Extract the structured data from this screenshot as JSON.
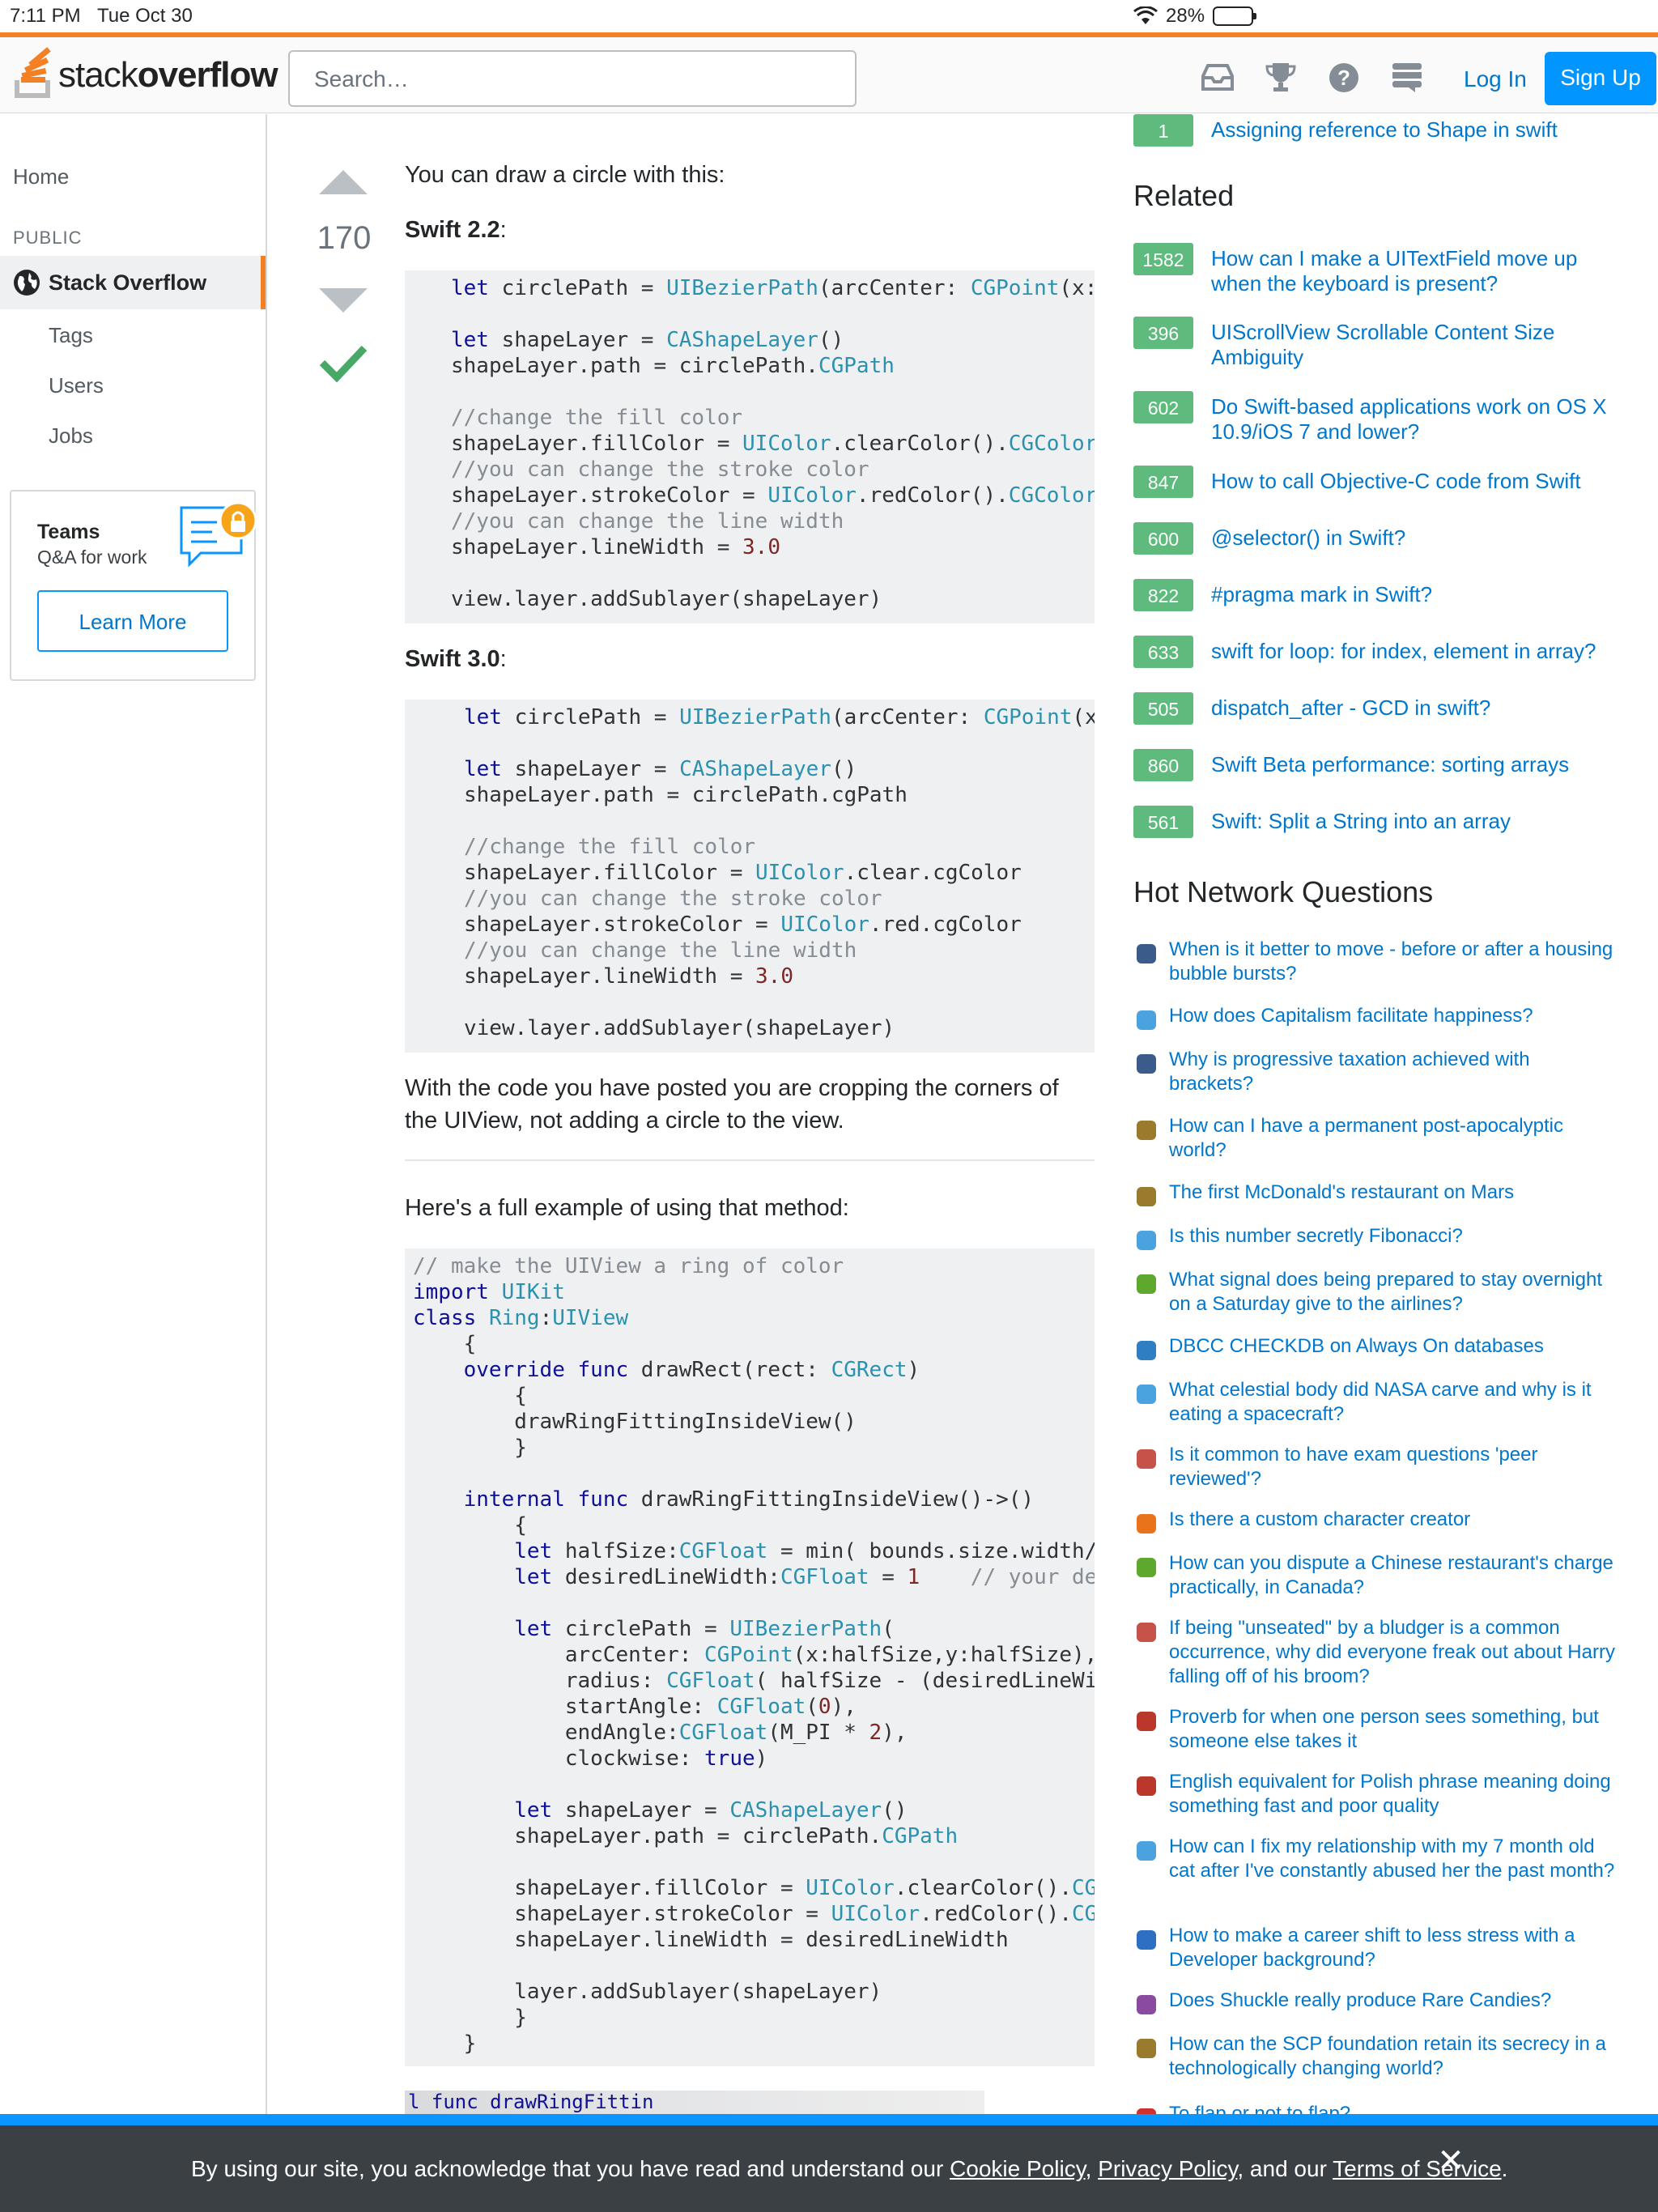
{
  "status_bar": {
    "time": "7:11 PM",
    "date": "Tue Oct 30",
    "battery": "28%"
  },
  "header": {
    "logo_light": "stack",
    "logo_bold": "overflow",
    "search_placeholder": "Search…",
    "login": "Log In",
    "signup": "Sign Up"
  },
  "leftnav": {
    "home": "Home",
    "public": "PUBLIC",
    "stack_overflow": "Stack Overflow",
    "tags": "Tags",
    "users": "Users",
    "jobs": "Jobs",
    "teams_title": "Teams",
    "teams_sub": "Q&A for work",
    "learn_more": "Learn More"
  },
  "answer": {
    "votes": "170",
    "intro": "You can draw a circle with this:",
    "swift22_label": "Swift 2.2",
    "swift30_label": "Swift 3.0",
    "after_code": "With the code you have posted you are cropping the corners of the UIView, not adding a circle to the view.",
    "full_example": "Here's a full example of using that method:",
    "image_peek": "l func drawRingFittin"
  },
  "right": {
    "top_link_count": "1",
    "top_link": "Assigning reference to Shape in swift",
    "related_title": "Related",
    "related": [
      {
        "count": "1582",
        "title": "How can I make a UITextField move up when the keyboard is present?"
      },
      {
        "count": "396",
        "title": "UIScrollView Scrollable Content Size Ambiguity"
      },
      {
        "count": "602",
        "title": "Do Swift-based applications work on OS X 10.9/iOS 7 and lower?"
      },
      {
        "count": "847",
        "title": "How to call Objective-C code from Swift"
      },
      {
        "count": "600",
        "title": "@selector() in Swift?"
      },
      {
        "count": "822",
        "title": "#pragma mark in Swift?"
      },
      {
        "count": "633",
        "title": "swift for loop: for index, element in array?"
      },
      {
        "count": "505",
        "title": "dispatch_after - GCD in swift?"
      },
      {
        "count": "860",
        "title": "Swift Beta performance: sorting arrays"
      },
      {
        "count": "561",
        "title": "Swift: Split a String into an array"
      }
    ],
    "hnq_title": "Hot Network Questions",
    "hnq": [
      {
        "icon": "money-site-icon",
        "color": "#3b5b8a",
        "title": "When is it better to move - before or after a housing bubble bursts?"
      },
      {
        "icon": "politics-site-icon",
        "color": "#4aa3df",
        "title": "How does Capitalism facilitate happiness?"
      },
      {
        "icon": "money-site-icon",
        "color": "#3b5b8a",
        "title": "Why is progressive taxation achieved with brackets?"
      },
      {
        "icon": "worldbuilding-site-icon",
        "color": "#9a7b2d",
        "title": "How can I have a permanent post-apocalyptic world?"
      },
      {
        "icon": "worldbuilding-site-icon",
        "color": "#9a7b2d",
        "title": "The first McDonald's restaurant on Mars"
      },
      {
        "icon": "puzzling-site-icon",
        "color": "#4aa3df",
        "title": "Is this number secretly Fibonacci?"
      },
      {
        "icon": "aviation-site-icon",
        "color": "#5ea92d",
        "title": "What signal does being prepared to stay overnight on a Saturday give to the airlines?"
      },
      {
        "icon": "dba-site-icon",
        "color": "#2f7ec1",
        "title": "DBCC CHECKDB on Always On databases"
      },
      {
        "icon": "space-site-icon",
        "color": "#4aa3df",
        "title": "What celestial body did NASA carve and why is it eating a spacecraft?"
      },
      {
        "icon": "academia-site-icon",
        "color": "#c5534a",
        "title": "Is it common to have exam questions 'peer reviewed'?"
      },
      {
        "icon": "gamedev-site-icon",
        "color": "#e8731a",
        "title": "Is there a custom character creator"
      },
      {
        "icon": "travel-site-icon",
        "color": "#5ea92d",
        "title": "How can you dispute a Chinese restaurant's charge practically, in Canada?"
      },
      {
        "icon": "scifi-site-icon",
        "color": "#c5534a",
        "title": "If being \"unseated\" by a bludger is a common occurrence, why did everyone freak out about Harry falling off of his broom?"
      },
      {
        "icon": "english-site-icon",
        "color": "#b9372b",
        "title": "Proverb for when one person sees something, but someone else takes it"
      },
      {
        "icon": "english-site-icon",
        "color": "#b9372b",
        "title": "English equivalent for Polish phrase meaning doing something fast and poor quality"
      },
      {
        "icon": "pets-site-icon",
        "color": "#4aa3df",
        "title": "How can I fix my relationship with my 7 month old cat after I've constantly abused her the past month?"
      },
      {
        "icon": "workplace-site-icon",
        "color": "#2d6fc2",
        "title": "How to make a career shift to less stress with a Developer background?"
      },
      {
        "icon": "pokemon-site-icon",
        "color": "#8a4aa0",
        "title": "Does Shuckle really produce Rare Candies?"
      },
      {
        "icon": "worldbuilding-site-icon",
        "color": "#9a7b2d",
        "title": "How can the SCP foundation retain its secrecy in a technologically changing world?"
      },
      {
        "icon": "bird-site-icon",
        "color": "#d0312d",
        "title": "To flap or not to flap?"
      }
    ]
  },
  "cookie": {
    "before": "By using our site, you acknowledge that you have read and understand our ",
    "cookie_policy": "Cookie Policy",
    "sep1": ", ",
    "privacy_policy": "Privacy Policy",
    "sep2": ", and our ",
    "terms": "Terms of Service",
    "after": ".",
    "close": "✕"
  }
}
